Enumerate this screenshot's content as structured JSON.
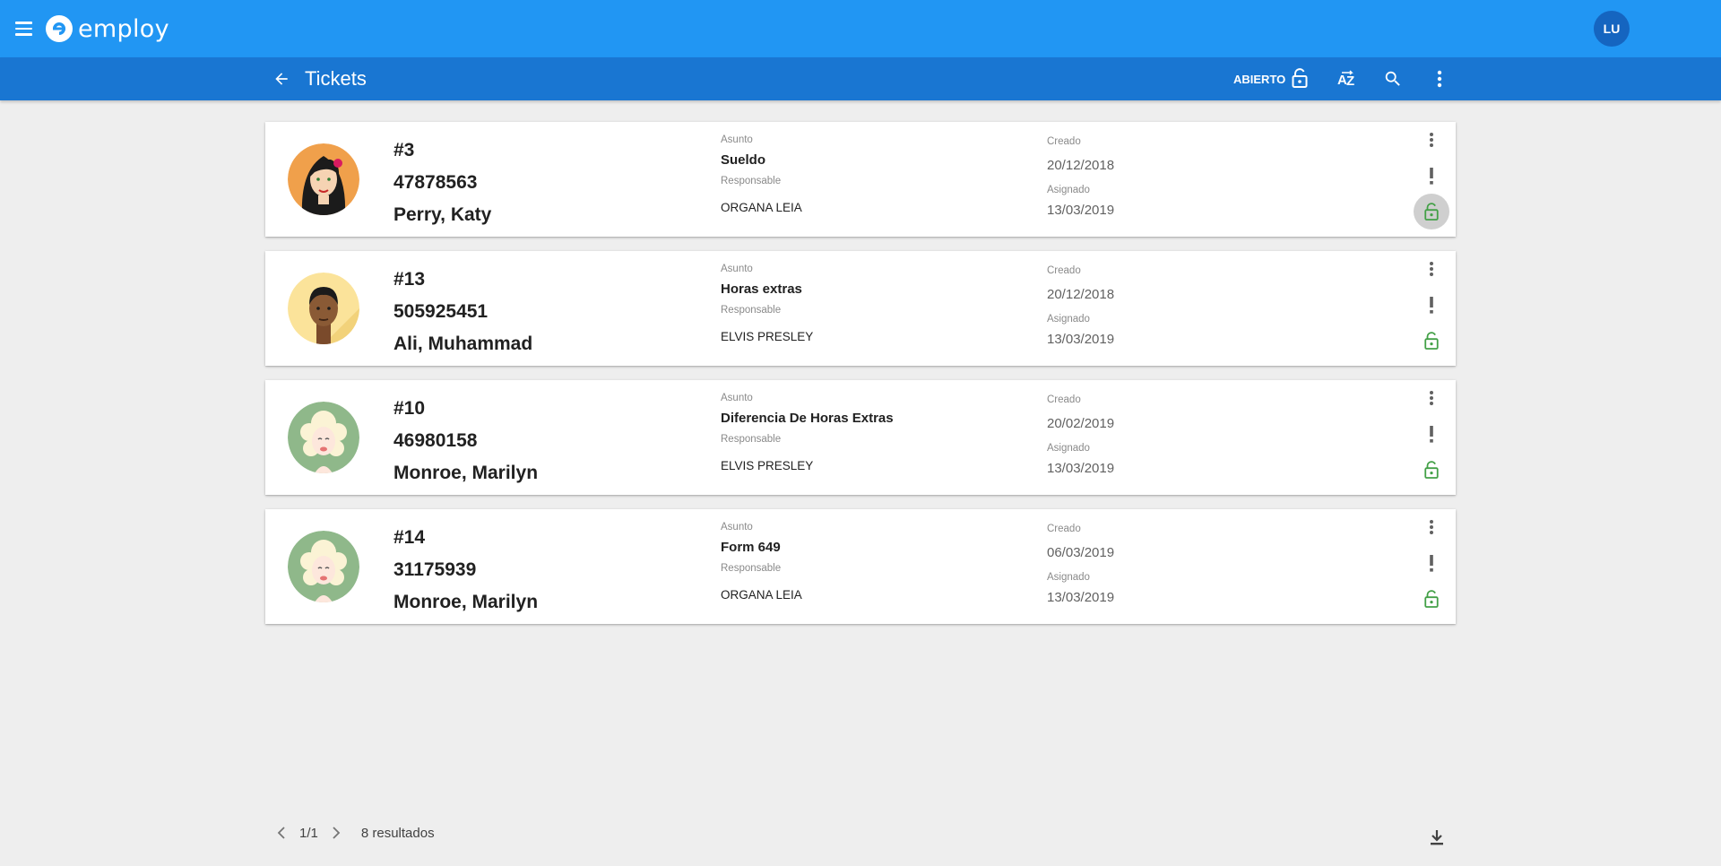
{
  "app": {
    "logo_text": "employ",
    "user_initials": "LU",
    "colors": {
      "appbar": "#2196f3",
      "toolbar": "#1976d2",
      "avatar": "#1565c0",
      "lock": "#43a047"
    }
  },
  "toolbar": {
    "title": "Tickets",
    "filter_label": "ABIERTO",
    "icons": [
      "arrow-back-icon",
      "lock-open-icon",
      "sort-az-icon",
      "search-icon",
      "more-vert-icon"
    ]
  },
  "tickets": [
    {
      "number": "#3",
      "id": "47878563",
      "name": "Perry, Katy",
      "subject_label": "Asunto",
      "subject": "Sueldo",
      "responsible_label": "Responsable",
      "responsible": "ORGANA LEIA",
      "created_label": "Creado",
      "created": "20/12/2018",
      "assigned_label": "Asignado",
      "assigned": "13/03/2019",
      "avatar": "woman-dark-hair-flower",
      "lock_active": true
    },
    {
      "number": "#13",
      "id": "505925451",
      "name": "Ali, Muhammad",
      "subject_label": "Asunto",
      "subject": "Horas extras",
      "responsible_label": "Responsable",
      "responsible": "ELVIS PRESLEY",
      "created_label": "Creado",
      "created": "20/12/2018",
      "assigned_label": "Asignado",
      "assigned": "13/03/2019",
      "avatar": "man-dark-skin",
      "lock_active": false
    },
    {
      "number": "#10",
      "id": "46980158",
      "name": "Monroe, Marilyn",
      "subject_label": "Asunto",
      "subject": "Diferencia De Horas Extras",
      "responsible_label": "Responsable",
      "responsible": "ELVIS PRESLEY",
      "created_label": "Creado",
      "created": "20/02/2019",
      "assigned_label": "Asignado",
      "assigned": "13/03/2019",
      "avatar": "woman-blonde-curls",
      "lock_active": false
    },
    {
      "number": "#14",
      "id": "31175939",
      "name": "Monroe, Marilyn",
      "subject_label": "Asunto",
      "subject": "Form 649",
      "responsible_label": "Responsable",
      "responsible": "ORGANA LEIA",
      "created_label": "Creado",
      "created": "06/03/2019",
      "assigned_label": "Asignado",
      "assigned": "13/03/2019",
      "avatar": "woman-blonde-curls",
      "lock_active": false
    }
  ],
  "footer": {
    "page": "1/1",
    "results": "8 resultados"
  }
}
